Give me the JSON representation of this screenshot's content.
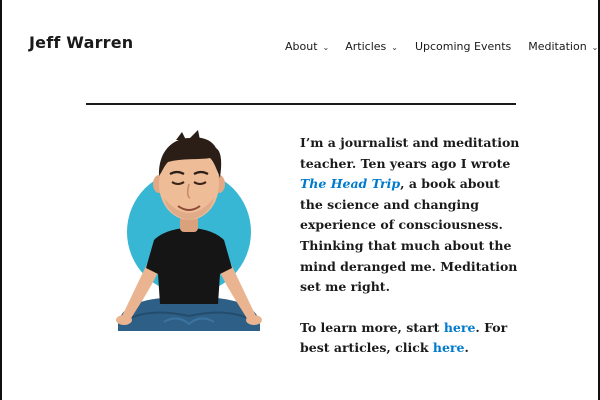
{
  "site": {
    "title": "Jeff Warren"
  },
  "nav": {
    "items": [
      {
        "label": "About",
        "has_dropdown": true
      },
      {
        "label": "Articles",
        "has_dropdown": true
      },
      {
        "label": "Upcoming Events",
        "has_dropdown": false
      },
      {
        "label": "Meditation",
        "has_dropdown": true
      }
    ],
    "chevron": "⌄"
  },
  "bio": {
    "para1_before": "I’m a journalist and meditation teacher. Ten years ago I wrote ",
    "book_link": "The Head Trip",
    "para1_after": ", a book about the science and changing experience of consciousness. Thinking that much about the mind deranged me. Meditation set me right.",
    "para2_before": "To learn more, start ",
    "link_start": "here",
    "para2_middle": ". For best articles, click ",
    "link_articles": "here",
    "para2_after": "."
  },
  "colors": {
    "link": "#007acc",
    "circle": "#38b7d4",
    "text": "#1a1a1a"
  },
  "icons": {
    "dropdown": "chevron-down-icon"
  }
}
